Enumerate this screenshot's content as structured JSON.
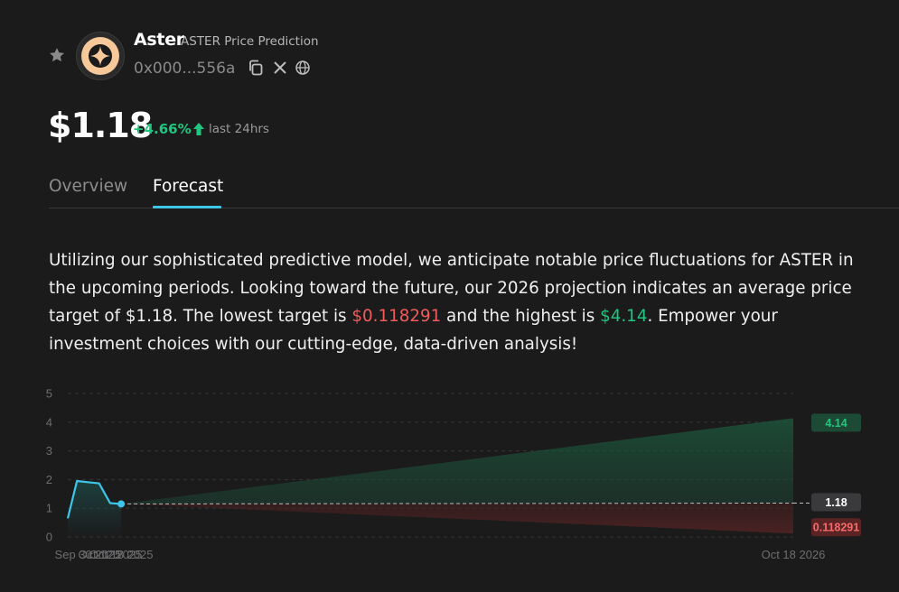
{
  "header": {
    "name": "Aster",
    "subtitle": "ASTER Price Prediction",
    "address": "0x000...556a"
  },
  "price": {
    "value": "$1.18",
    "change": "+4.66%",
    "change_label": "last 24hrs"
  },
  "tabs": [
    {
      "label": "Overview",
      "active": false
    },
    {
      "label": "Forecast",
      "active": true
    }
  ],
  "description": {
    "part1": "Utilizing our sophisticated predictive model, we anticipate notable price fluctuations for ASTER in the upcoming periods. Looking toward the future, our 2026 projection indicates an average price target of $1.18. The lowest target is ",
    "low": "$0.118291",
    "part2": " and the highest is ",
    "high": "$4.14",
    "part3": ". Empower your investment choices with our cutting-edge, data-driven analysis!"
  },
  "colors": {
    "background": "#1b1b1c",
    "accent": "#3ec6e8",
    "positive": "#1fc77e",
    "negative": "#f15b5b"
  },
  "chart_data": {
    "type": "line",
    "ylim": [
      0,
      5
    ],
    "yticks": [
      "0",
      "1",
      "2",
      "3",
      "4",
      "5"
    ],
    "x_tick_labels": [
      "Sep 30 2025",
      "Oct 12 2025",
      "Oct 18 2025",
      "Oct 18 2026"
    ],
    "grid": true,
    "history": {
      "x": [
        "Sep 19 2025",
        "Sep 24 2025",
        "Oct 1 2025",
        "Oct 6 2025",
        "Oct 12 2025",
        "Oct 18 2025"
      ],
      "y": [
        0.65,
        1.95,
        1.9,
        1.87,
        1.18,
        1.15
      ]
    },
    "forecast": {
      "start_date": "Oct 18 2025",
      "start_value": 1.15,
      "end_date": "Oct 18 2026",
      "high": 4.14,
      "average": 1.18,
      "low": 0.118291
    },
    "labels": {
      "high": "4.14",
      "average": "1.18",
      "low": "0.118291"
    }
  }
}
